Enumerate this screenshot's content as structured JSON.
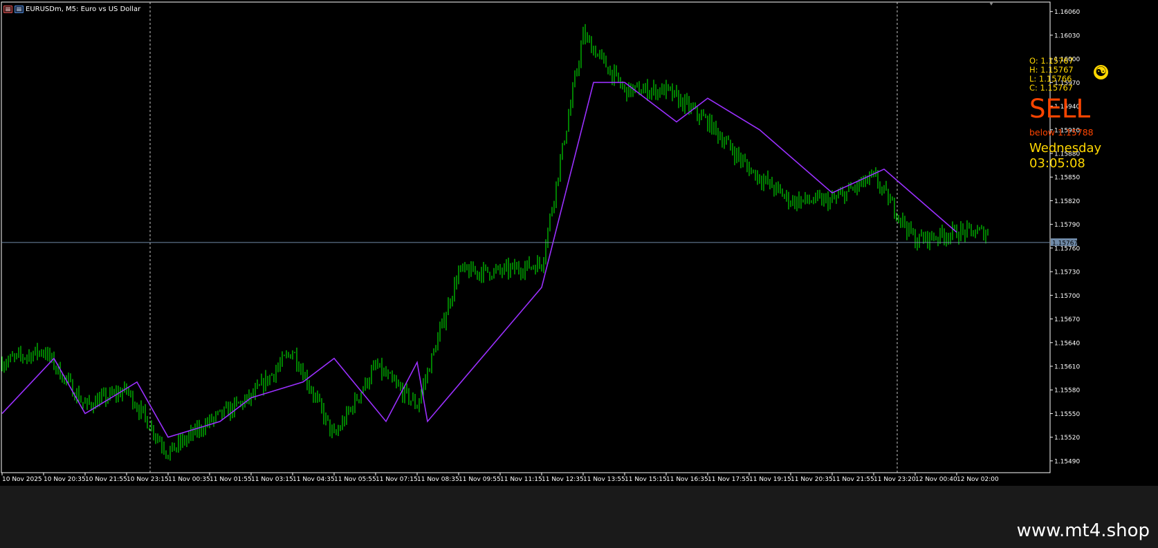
{
  "window": {
    "symbol_title": "EURUSDm, M5:  Euro vs US Dollar"
  },
  "icons": [
    "chart-menu-icon",
    "indicators-icon",
    "yin-yang-icon"
  ],
  "colors": {
    "background": "#000000",
    "candles": "#00ff00",
    "zigzag": "#9b30ff",
    "axis": "#ffffff",
    "bid_line": "#6f8aa8",
    "sell": "#ff4500",
    "info": "#ffd700"
  },
  "ohlc": {
    "open": "O: 1.15767",
    "high": "H: 1.15767",
    "low": "L: 1.15766",
    "close": "C: 1.15767"
  },
  "signal": {
    "label": "SELL",
    "below_text": "below 1.15788",
    "day": "Wednesday",
    "time": "03:05:08"
  },
  "watermark": "www.mt4.shop",
  "chart_data": {
    "type": "candlestick",
    "symbol": "EURUSDm",
    "timeframe": "M5",
    "ylim": [
      1.1547,
      1.1607
    ],
    "y_ticks": [
      "1.16060",
      "1.16030",
      "1.16000",
      "1.15970",
      "1.15940",
      "1.15910",
      "1.15880",
      "1.15850",
      "1.15820",
      "1.15790",
      "1.15760",
      "1.15730",
      "1.15700",
      "1.15670",
      "1.15640",
      "1.15610",
      "1.15580",
      "1.15550",
      "1.15520",
      "1.15490"
    ],
    "x_ticks": [
      "10 Nov 2025",
      "10 Nov 20:35",
      "10 Nov 21:55",
      "10 Nov 23:15",
      "11 Nov 00:35",
      "11 Nov 01:55",
      "11 Nov 03:15",
      "11 Nov 04:35",
      "11 Nov 05:55",
      "11 Nov 07:15",
      "11 Nov 08:35",
      "11 Nov 09:55",
      "11 Nov 11:15",
      "11 Nov 12:35",
      "11 Nov 13:55",
      "11 Nov 15:15",
      "11 Nov 16:35",
      "11 Nov 17:55",
      "11 Nov 19:15",
      "11 Nov 20:35",
      "11 Nov 21:55",
      "11 Nov 23:20",
      "12 Nov 00:40",
      "12 Nov 02:00"
    ],
    "day_separators": [
      "10 Nov 23:15",
      "11 Nov 23:20"
    ],
    "current_price": 1.15767,
    "current_price_label": "1.15767",
    "price_path": [
      [
        "10 Nov 2025",
        1.15615
      ],
      [
        "10 Nov 20:35",
        1.1563
      ],
      [
        "10 Nov 21:55",
        1.1556
      ],
      [
        "10 Nov 23:15",
        1.1558
      ],
      [
        "11 Nov 00:35",
        1.155
      ],
      [
        "11 Nov 01:55",
        1.1554
      ],
      [
        "11 Nov 03:15",
        1.1557
      ],
      [
        "11 Nov 04:35",
        1.1563
      ],
      [
        "11 Nov 05:55",
        1.1552
      ],
      [
        "11 Nov 07:15",
        1.1561
      ],
      [
        "11 Nov 08:35",
        1.1556
      ],
      [
        "11 Nov 09:55",
        1.1573
      ],
      [
        "11 Nov 11:15",
        1.1573
      ],
      [
        "11 Nov 12:35",
        1.1574
      ],
      [
        "11 Nov 13:55",
        1.1603
      ],
      [
        "11 Nov 15:15",
        1.1596
      ],
      [
        "11 Nov 16:35",
        1.1596
      ],
      [
        "11 Nov 17:55",
        1.1592
      ],
      [
        "11 Nov 19:15",
        1.1586
      ],
      [
        "11 Nov 20:35",
        1.1582
      ],
      [
        "11 Nov 21:55",
        1.1582
      ],
      [
        "11 Nov 23:20",
        1.1585
      ],
      [
        "12 Nov 00:40",
        1.1577
      ],
      [
        "12 Nov 02:00",
        1.1578
      ]
    ],
    "zigzag": [
      [
        "10 Nov 2025",
        1.1555
      ],
      [
        "10 Nov 20:35",
        1.1562
      ],
      [
        "10 Nov 21:55",
        1.1555
      ],
      [
        "10 Nov 23:15",
        1.1559
      ],
      [
        "11 Nov 00:35",
        1.1552
      ],
      [
        "11 Nov 01:55",
        1.1554
      ],
      [
        "11 Nov 03:15",
        1.1557
      ],
      [
        "11 Nov 04:35",
        1.1559
      ],
      [
        "11 Nov 05:55",
        1.1562
      ],
      [
        "11 Nov 07:15",
        1.1554
      ],
      [
        "11 Nov 08:35",
        1.15615
      ],
      [
        "11 Nov 08:35",
        1.1554
      ],
      [
        "11 Nov 12:35",
        1.1571
      ],
      [
        "11 Nov 13:55",
        1.1597
      ],
      [
        "11 Nov 15:15",
        1.1597
      ],
      [
        "11 Nov 16:35",
        1.1592
      ],
      [
        "11 Nov 17:55",
        1.1595
      ],
      [
        "11 Nov 19:15",
        1.1591
      ],
      [
        "11 Nov 21:55",
        1.1583
      ],
      [
        "11 Nov 23:20",
        1.1586
      ],
      [
        "12 Nov 02:00",
        1.1578
      ]
    ]
  }
}
